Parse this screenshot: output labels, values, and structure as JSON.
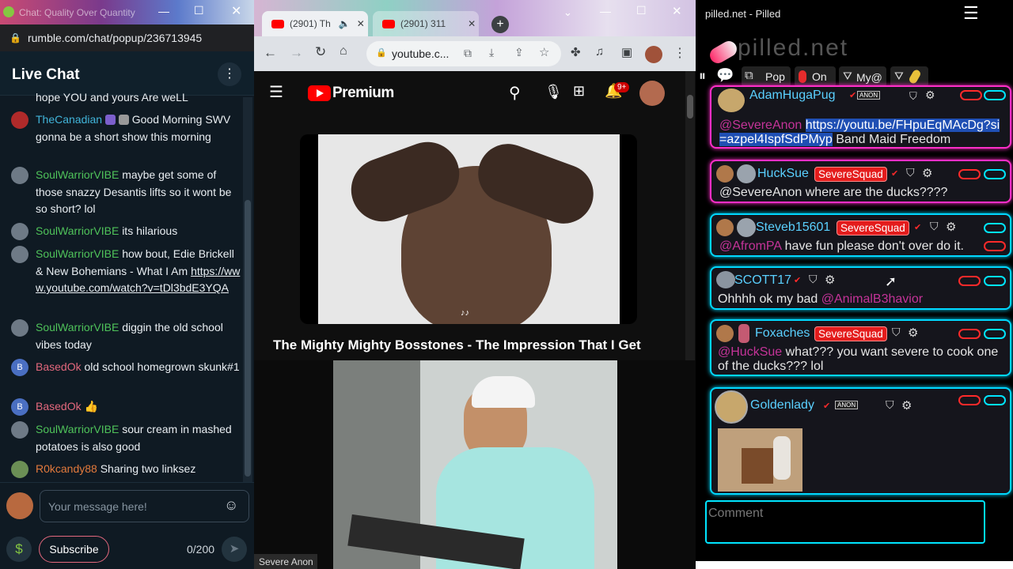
{
  "rumble": {
    "tab_title": "Chat: Quality Over Quantity",
    "url": "rumble.com/chat/popup/236713945",
    "header_title": "Live Chat",
    "top_fragment": "hope YOU and yours Are weLL",
    "messages": [
      {
        "user": "TheCanadian",
        "color": "#41b4d9",
        "text": "Good Morning SWV gonna be a short show this morning"
      },
      {
        "user": "SoulWarriorVIBE",
        "color": "#4fc35a",
        "text": "maybe get some of those snazzy Desantis lifts so it wont be so short? lol"
      },
      {
        "user": "SoulWarriorVIBE",
        "color": "#4fc35a",
        "text": "its hilarious"
      },
      {
        "user": "SoulWarriorVIBE",
        "color": "#4fc35a",
        "text": "how bout, Edie Brickell & New Bohemians - What I Am",
        "link": "https://www.youtube.com/watch?v=tDl3bdE3YQA"
      },
      {
        "user": "SoulWarriorVIBE",
        "color": "#4fc35a",
        "text": "diggin the old school vibes today"
      },
      {
        "user": "BasedOk",
        "color": "#e3687d",
        "text": "old school homegrown skunk#1"
      },
      {
        "user": "BasedOk",
        "color": "#e3687d",
        "text": "👍"
      },
      {
        "user": "SoulWarriorVIBE",
        "color": "#4fc35a",
        "text": "sour cream in mashed potatoes is also good"
      },
      {
        "user": "R0kcandy88",
        "color": "#e37a3c",
        "text": "Sharing two linksez"
      }
    ],
    "input_placeholder": "Your message here!",
    "subscribe_label": "Subscribe",
    "char_count": "0/200"
  },
  "chrome": {
    "tabs": [
      {
        "title": "(2901) Th"
      },
      {
        "title": "(2901) 311"
      }
    ],
    "url": "youtube.c..."
  },
  "youtube": {
    "brand": "Premium",
    "notif_count": "9+",
    "video_title": "The Mighty Mighty Bosstones - The Impression That I Get"
  },
  "cam_label": "Severe Anon",
  "pilled": {
    "window_title": "pilled.net - Pilled",
    "logo_text": "pilled.net",
    "toolbar": {
      "pop": "Pop",
      "on": "On",
      "my": "My@"
    },
    "cards": [
      {
        "user": "AdamHugaPug",
        "badge": "ANON",
        "mention": "@SevereAnon",
        "link": "https://youtu.be/FHpuEqMAcDg?si=azpel4IspfSdPMyp",
        "text": "Band Maid Freedom"
      },
      {
        "user": "HuckSue",
        "badge": "SevereSquad",
        "text": "@SevereAnon where are the ducks????"
      },
      {
        "user": "Steveb15601",
        "badge": "SevereSquad",
        "mention": "@AfromPA",
        "text": "have fun please don't over do it."
      },
      {
        "user": "SCOTT17",
        "text": "Ohhhh ok my bad",
        "mention": "@AnimalB3havior"
      },
      {
        "user": "Foxaches",
        "badge": "SevereSquad",
        "mention": "@HuckSue",
        "text": "what??? you want severe to cook one of the ducks??? lol"
      },
      {
        "user": "Goldenlady",
        "badge": "ANON"
      }
    ],
    "comment_placeholder": "Comment"
  }
}
